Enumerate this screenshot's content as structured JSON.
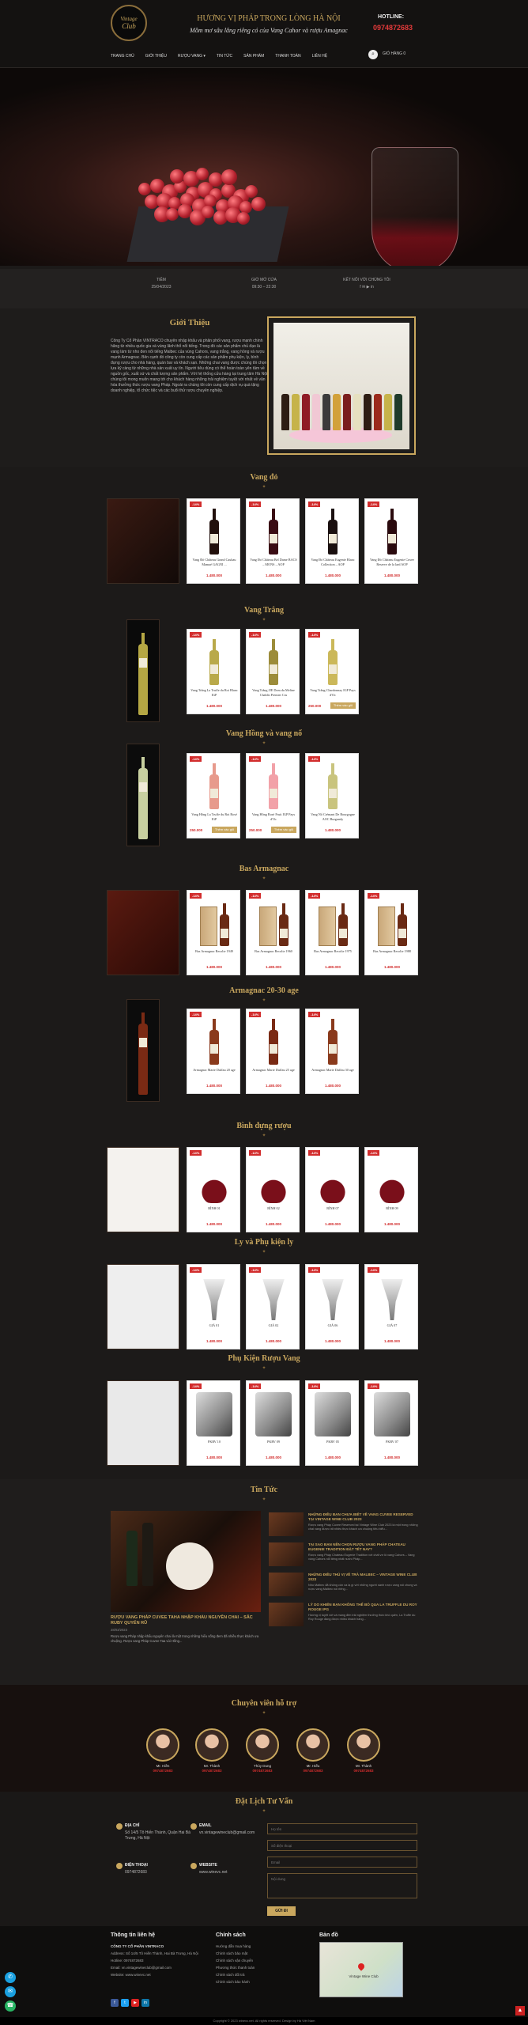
{
  "header": {
    "logo_top": "Vintage",
    "logo_bottom": "Club",
    "slogan": "HƯƠNG VỊ PHÁP TRONG LÒNG HÀ NỘI",
    "subslogan": "Mồm mơ sâu lắng riêng có của Vang Cahor và rượu Amagnac",
    "hotline_label": "HOTLINE:",
    "hotline": "0974872683",
    "nav": [
      "TRANG CHỦ",
      "GIỚI THIỆU",
      "RƯỢU VANG ▾",
      "TIN TỨC",
      "SẢN PHẨM",
      "THANH TOÁN",
      "LIÊN HỆ"
    ],
    "search_icon": "search-icon",
    "cart_label": "GIỎ HÀNG 0"
  },
  "infobar": {
    "col1": [
      "TIÊM",
      "25/04/2023"
    ],
    "col2": [
      "GIỜ MỞ CỬA",
      "09:30 – 22:30"
    ],
    "col3": [
      "KẾT NỐI VỚI CHÚNG TÔI",
      "f  ✉  ▶  in"
    ]
  },
  "intro": {
    "title": "Giới Thiệu",
    "text": "Công Ty Cổ Phần VINTRACO chuyên nhập khẩu và phân phối vang, rượu mạnh chính hãng từ nhiều quốc gia và vùng lãnh thổ nổi tiếng. Trong đó các sản phẩm chủ đạo là vang làm từ nho đen nổi tiếng Malbec của vùng Cahors, vang trắng, vang hồng và rượu mạnh Armagnac. Bên cạnh đó công ty còn cung cấp các sản phẩm phụ kiện, ly, bình đựng rượu cho nhà hàng, quán bar và khách sạn. Những chai vang được chúng tôi chọn lựa kỹ càng từ những nhà sản xuất uy tín. Người tiêu dùng có thể hoàn toàn yên tâm về nguồn gốc, xuất xứ và chất lượng sản phẩm. Với hệ thống cửa hàng tại trung tâm Hà Nội, chúng tôi mong muốn mang tới cho khách hàng những trải nghiệm tuyệt vời nhất về văn hóa thưởng thức rượu vang Pháp. Ngoài ra chúng tôi còn cung cấp dịch vụ quà tặng doanh nghiệp, tổ chức tiệc và các buổi thử rượu chuyên nghiệp."
  },
  "sections": {
    "vang_do": "Vang đỏ",
    "vang_trang": "Vang Trắng",
    "vang_hong": "Vang Hồng và vang nổ",
    "bas_armagnac": "Bas Armagnac",
    "armagnac_2030": "Armagnac 20-30 age",
    "binh": "Bình đựng rượu",
    "ly": "Ly và Phụ kiện ly",
    "phukien": "Phụ Kiện Rượu Vang",
    "news": "Tin Tức",
    "experts": "Chuyên viên hỗ trợ",
    "booking": "Đặt Lịch Tư Vấn"
  },
  "products": {
    "badge": "-14%",
    "cart_btn": "Thêm vào giỏ",
    "vang_do": [
      {
        "name": "Vang Đỏ Château Grand Cauhau Mamaé GAGNI ...",
        "price": "1.480.000"
      },
      {
        "name": "Vang Đỏ Château Bel Dame BACS – MONS – AOP",
        "price": "1.480.000"
      },
      {
        "name": "Vang Đỏ Château Eugenie Blanc Collection – AOP",
        "price": "1.480.000"
      },
      {
        "name": "Vang Đỏ Château Eugenie Cuvee Reserve de la lard AOP",
        "price": "1.480.000"
      }
    ],
    "vang_trang": [
      {
        "name": "Vang Trắng La Truffe du Roi Blanc IGP",
        "price": "1.480.000"
      },
      {
        "name": "Vang Trắng JJE Dom du Meline Chablis Premier Cru",
        "price": "1.480.000"
      },
      {
        "name": "Vang Trắng Chardonnay IGP Pays d'Oc",
        "price": "250.000"
      }
    ],
    "vang_hong": [
      {
        "name": "Vang Hồng La Truffe du Roi Rosé IGP",
        "price": "250.000"
      },
      {
        "name": "Vang Hồng Rosé Fruit IGP Pays d'Oc",
        "price": "250.000"
      },
      {
        "name": "Vang Nổ Crémant De Bourgogne AOC Burgundy",
        "price": "1.480.000"
      }
    ],
    "bas_armagnac": [
      {
        "name": "Bas Armagnac Recolte 1949",
        "price": "1.480.000"
      },
      {
        "name": "Bas Armagnac Recolte 1960",
        "price": "1.480.000"
      },
      {
        "name": "Bas Armagnac Recolte 1975",
        "price": "1.480.000"
      },
      {
        "name": "Bas Armagnac Recolte 1988",
        "price": "1.480.000"
      }
    ],
    "armagnac_2030": [
      {
        "name": "Armagnac Marie Duffau 20 age",
        "price": "1.480.000"
      },
      {
        "name": "Armagnac Marie Duffau 25 age",
        "price": "1.480.000"
      },
      {
        "name": "Armagnac Marie Duffau 30 age",
        "price": "1.480.000"
      }
    ],
    "binh": [
      {
        "name": "BÌNH 01",
        "price": "1.480.000"
      },
      {
        "name": "BÌNH 02",
        "price": "1.480.000"
      },
      {
        "name": "BÌNH 07",
        "price": "1.480.000"
      },
      {
        "name": "BÌNH 09",
        "price": "1.480.000"
      }
    ],
    "ly": [
      {
        "name": "GIÁ 01",
        "price": "1.480.000"
      },
      {
        "name": "GIÁ 02",
        "price": "1.480.000"
      },
      {
        "name": "GIÁ 06",
        "price": "1.480.000"
      },
      {
        "name": "GIÁ 07",
        "price": "1.480.000"
      }
    ],
    "phukien": [
      {
        "name": "PKRV 10",
        "price": "1.480.000"
      },
      {
        "name": "PKRV 09",
        "price": "1.480.000"
      },
      {
        "name": "PKRV 05",
        "price": "1.480.000"
      },
      {
        "name": "PKRV 07",
        "price": "1.480.000"
      }
    ]
  },
  "news": {
    "featured_title": "RƯỢU VANG PHÁP CUVEE TAHA NHẬP KHẨU NGUYÊN CHAI – SẮC RUBY QUYẾN RŨ",
    "featured_date": "28/03/2023",
    "featured_text": "Rượu vang Pháp nhập khẩu nguyên chai là một trong những hiểu sống đem đã nhiều thực khách ưa chuộng. Rượu vang Pháp Cuvee Taa vùi Hồng...",
    "items": [
      {
        "title": "NHỮNG ĐIỀU BẠN CHƯA BIẾT VỀ VANG CUVEE RESERVED TẠI VINTAGE WINE CLUB 2023",
        "text": "Rượu vang Pháp Cuvee Reserved tại Vintage Wine Club 2023 là một trong những chai vang được rất nhiều thực khách ưa chuộng tiêu biểu..."
      },
      {
        "title": "TẠI SAO BẠN NÊN CHỌN RƯỢU VANG PHÁP CHATEAU EUGENIE TRADITION ĐẶT TẾT NAY?",
        "text": "Rượu vang Pháp Chateau Eugenie Tradition với chất vơ lô vang Cahors – Vang vùng Cahors nổi tiếng nhất nước Pháp..."
      },
      {
        "title": "NHỮNG ĐIỀU THÚ VỊ VỀ TRÀ MALBEC – VINTAGE WINE CLUB 2023",
        "text": "Nho Malbec đã không còn xa lạ gì với những người sành rượu vang nói chung và rượu vang Malbec nói riêng..."
      },
      {
        "title": "LÝ DO KHIẾN BẠN KHÔNG THỂ BỎ QUA LA TRUFFLE DU ROY ROUGE IPG",
        "text": "Hương vị tuyệt vời và mang đến trải nghiệm thưởng thức khó quên, La Truffe du Roy Rouge đang được nhiều khách hàng..."
      }
    ]
  },
  "experts": [
    {
      "name": "Mr. Hiền",
      "phone": "0974872683"
    },
    {
      "name": "Mr. Thành",
      "phone": "0974872683"
    },
    {
      "name": "Thùy Dung",
      "phone": "0974872683"
    },
    {
      "name": "Mr. Hiếu",
      "phone": "0974872683"
    },
    {
      "name": "Mr. Thành",
      "phone": "0974872683"
    }
  ],
  "booking": {
    "address_h": "ĐỊA CHỈ",
    "address": "Số 14/5 Tô Hiến Thành, Quận Hai Bà Trưng, Hà Nội",
    "email_h": "EMAIL",
    "email": "vn.vintagewineclub@gmail.com",
    "phone_h": "ĐIỆN THOẠI",
    "phone": "0974872683",
    "website_h": "WEBSITE",
    "website": "www.winevc.net",
    "fields": [
      "Họ tên",
      "Số điện thoại",
      "Email",
      "Nội dung"
    ],
    "submit": "GỬI ĐI"
  },
  "footer": {
    "col1_h": "Thông tin liên hệ",
    "col1": [
      "CÔNG TY CỔ PHẦN VINTRACO",
      "Address: Số 14/5 Tô Hiến Thành, Hai Bà Trưng, Hà Nội",
      "Hotline: 0974872683",
      "Email: vn.vintagewineclub@gmail.com",
      "Website: www.winevc.net"
    ],
    "col2_h": "Chính sách",
    "col2": [
      "Hướng dẫn mua hàng",
      "Chính sách bảo mật",
      "Chính sách vận chuyển",
      "Phương thức thanh toán",
      "Chính sách đổi trả",
      "Chính sách bảo hành"
    ],
    "col3_h": "Bản đồ",
    "map_label": "Vintage Wine Club",
    "copyright": "Copyright © 2023 winevc.net. All rights reserved. Design by Hà Việt Nam",
    "socials": [
      "f",
      "t",
      "▶",
      "in"
    ]
  },
  "floating": [
    "✆",
    "✉",
    "☎"
  ],
  "totop": "▲",
  "colors": {
    "accent": "#c9a75e",
    "price": "#d22d2d",
    "bg": "#1c1a19"
  }
}
